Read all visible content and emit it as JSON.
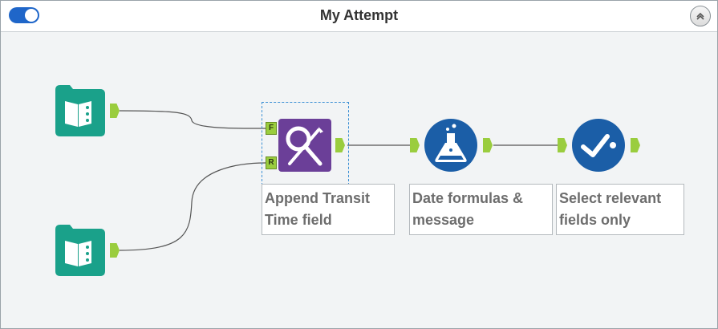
{
  "window": {
    "title": "My Attempt",
    "toggle_state": "on",
    "accent": "#1f66c9"
  },
  "tools": [
    {
      "id": "input-1",
      "icon": "book-input-icon",
      "color": "#1aa18a"
    },
    {
      "id": "input-2",
      "icon": "book-input-icon",
      "color": "#1aa18a"
    },
    {
      "id": "append",
      "icon": "append-fields-icon",
      "color": "#6b3f98",
      "label": "Append Transit Time field",
      "anchors": [
        "F",
        "R"
      ]
    },
    {
      "id": "formula",
      "icon": "flask-icon",
      "color": "#1b5ea7",
      "label": "Date formulas & message"
    },
    {
      "id": "select",
      "icon": "check-select-icon",
      "color": "#1b5ea7",
      "label": "Select relevant fields only"
    }
  ],
  "labels": {
    "append": "Append Transit Time field",
    "formula": "Date formulas & message",
    "select": "Select relevant fields only"
  },
  "anchors": {
    "append_f": "F",
    "append_r": "R"
  },
  "colors": {
    "anchor": "#9acd3e",
    "selection": "#3b8fd4",
    "canvas": "#f2f4f5"
  }
}
